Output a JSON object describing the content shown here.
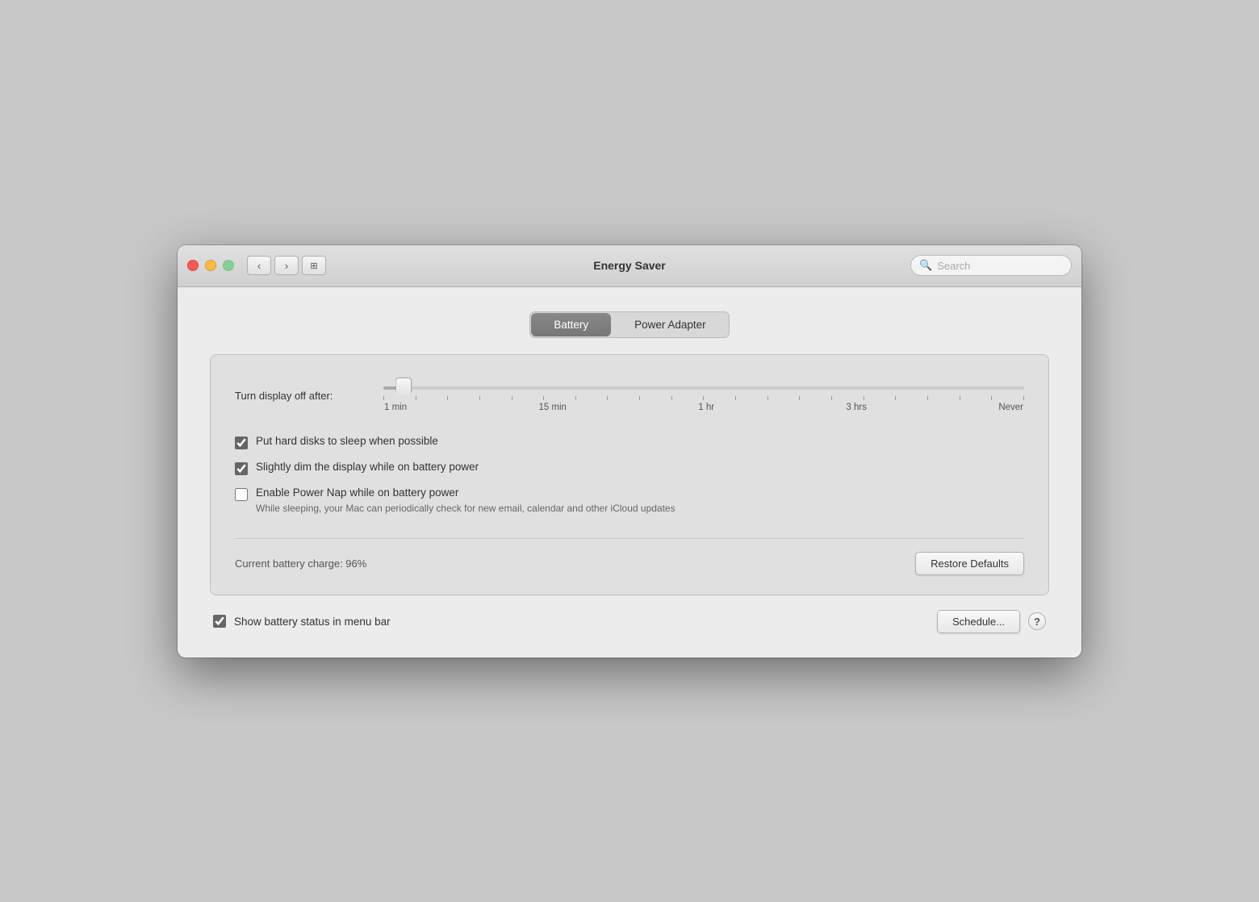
{
  "window": {
    "title": "Energy Saver",
    "search_placeholder": "Search"
  },
  "tabs": {
    "battery_label": "Battery",
    "power_adapter_label": "Power Adapter",
    "active": "battery"
  },
  "slider": {
    "label": "Turn display off after:",
    "value": 2,
    "min": 0,
    "max": 100,
    "tick_labels": [
      "1 min",
      "15 min",
      "1 hr",
      "3 hrs",
      "Never"
    ]
  },
  "checkboxes": {
    "hard_disks_label": "Put hard disks to sleep when possible",
    "hard_disks_checked": true,
    "dim_display_label": "Slightly dim the display while on battery power",
    "dim_display_checked": true,
    "power_nap_label": "Enable Power Nap while on battery power",
    "power_nap_checked": false,
    "power_nap_sub": "While sleeping, your Mac can periodically check for new email, calendar and other iCloud updates"
  },
  "battery_status": {
    "label": "Current battery charge: 96%"
  },
  "buttons": {
    "restore_defaults": "Restore Defaults",
    "schedule": "Schedule...",
    "help": "?"
  },
  "show_battery": {
    "label": "Show battery status in menu bar",
    "checked": true
  }
}
